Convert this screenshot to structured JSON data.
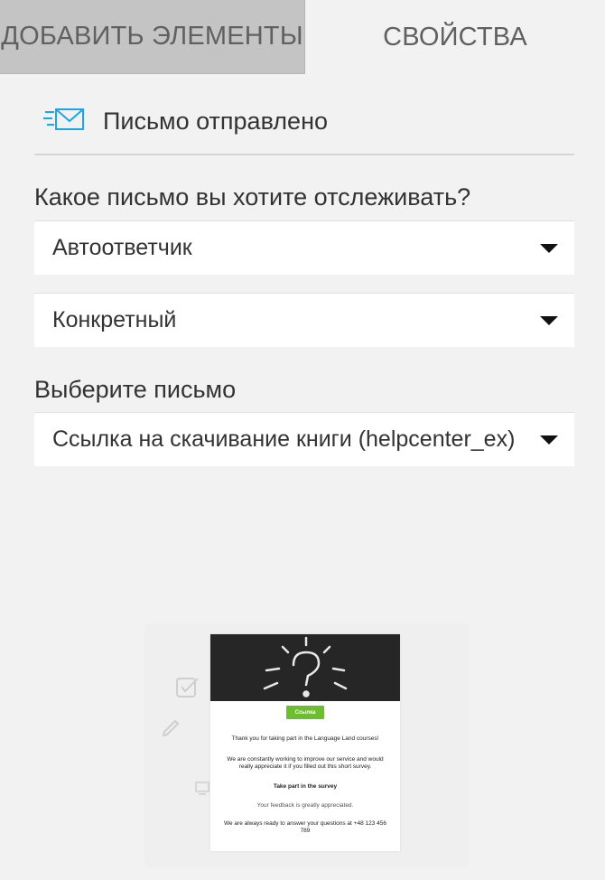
{
  "tabs": {
    "add_elements": "ДОБАВИТЬ ЭЛЕМЕНТЫ",
    "properties": "СВОЙСТВА"
  },
  "header": {
    "icon": "mail-sent-icon",
    "title": "Письмо отправлено"
  },
  "form": {
    "which_email_label": "Какое письмо вы хотите отслеживать?",
    "type_select": {
      "value": "Автоответчик"
    },
    "mode_select": {
      "value": "Конкретный"
    },
    "choose_email_label": "Выберите письмо",
    "email_select": {
      "value": "Ссылка на скачивание книги (helpcenter_ex)"
    }
  },
  "preview": {
    "button_label": "Ссылка",
    "line1": "Thank you for taking part in the Language Land courses!",
    "line2": "We are constantly working to improve our service and would really appreciate it if you filled out this short survey.",
    "line3": "Take part in the survey",
    "line4": "Your feedback is greatly appreciated.",
    "line5": "We are always ready to answer your questions at +48 123 456 789"
  },
  "colors": {
    "accent_icon": "#1aa6e8",
    "active_tab_bg": "#c4c4c4",
    "preview_button": "#6cbd2f"
  }
}
